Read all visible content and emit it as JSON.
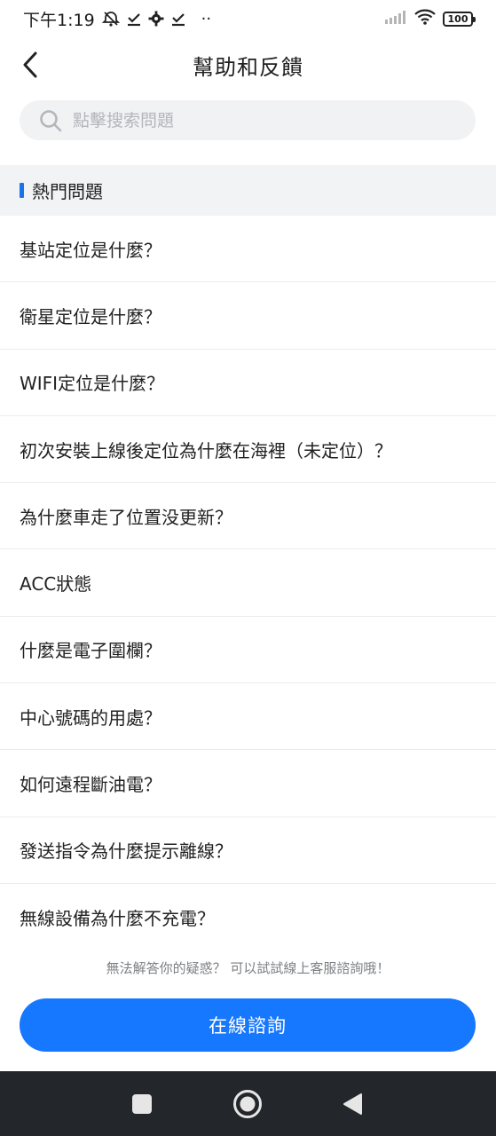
{
  "status_bar": {
    "time": "下午1:19",
    "extra_dots": "··",
    "battery": "100"
  },
  "header": {
    "title": "幫助和反饋"
  },
  "search": {
    "placeholder": "點擊搜索問題"
  },
  "section": {
    "title": "熱門問題",
    "accent_color": "#1a73e8"
  },
  "faq": [
    "基站定位是什麼？",
    "衛星定位是什麼？",
    "WIFI定位是什麼？",
    "初次安裝上線後定位為什麼在海裡（未定位）？",
    "為什麼車走了位置没更新？",
    "ACC狀態",
    "什麼是電子圍欄？",
    "中心號碼的用處？",
    "如何遠程斷油電？",
    "發送指令為什麼提示離線？",
    "無線設備為什麼不充電？"
  ],
  "footer": {
    "hint": "無法解答你的疑惑？ 可以試試線上客服諮詢哦！",
    "consult_label": "在線諮詢",
    "button_color": "#1677ff"
  },
  "icons": {
    "back": "chevron-left-icon",
    "search": "search-icon",
    "nav_recent": "square-icon",
    "nav_home": "circle-icon",
    "nav_back": "triangle-left-icon"
  }
}
